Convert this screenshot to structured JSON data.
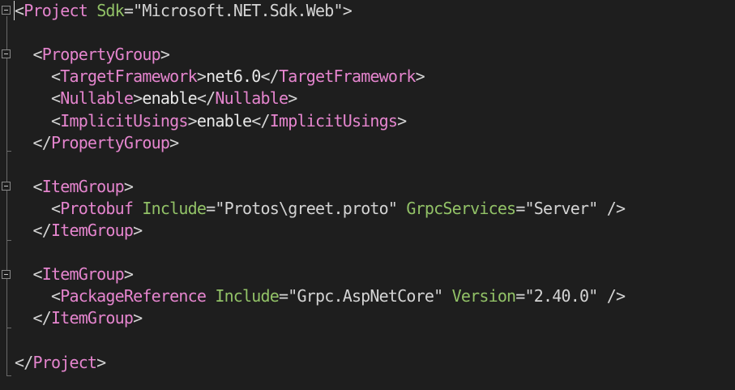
{
  "editor": {
    "language": "xml",
    "colors": {
      "background": "#1e1e1e",
      "punctuation": "#d4d4d4",
      "tag": "#e585ce",
      "attribute": "#92c267",
      "text": "#e8e8e8"
    },
    "lines": [
      {
        "indent": "",
        "tokens": [
          {
            "t": "<",
            "k": "punct"
          },
          {
            "t": "Project",
            "k": "tag"
          },
          {
            "t": " ",
            "k": "text"
          },
          {
            "t": "Sdk",
            "k": "attr"
          },
          {
            "t": "=\"Microsoft.NET.Sdk.Web\">",
            "k": "punct"
          }
        ]
      },
      {
        "indent": "",
        "tokens": []
      },
      {
        "indent": "  ",
        "tokens": [
          {
            "t": "<",
            "k": "punct"
          },
          {
            "t": "PropertyGroup",
            "k": "tag"
          },
          {
            "t": ">",
            "k": "punct"
          }
        ]
      },
      {
        "indent": "    ",
        "tokens": [
          {
            "t": "<",
            "k": "punct"
          },
          {
            "t": "TargetFramework",
            "k": "tag"
          },
          {
            "t": ">",
            "k": "punct"
          },
          {
            "t": "net6.0",
            "k": "text"
          },
          {
            "t": "</",
            "k": "punct"
          },
          {
            "t": "TargetFramework",
            "k": "tag"
          },
          {
            "t": ">",
            "k": "punct"
          }
        ]
      },
      {
        "indent": "    ",
        "tokens": [
          {
            "t": "<",
            "k": "punct"
          },
          {
            "t": "Nullable",
            "k": "tag"
          },
          {
            "t": ">",
            "k": "punct"
          },
          {
            "t": "enable",
            "k": "text"
          },
          {
            "t": "</",
            "k": "punct"
          },
          {
            "t": "Nullable",
            "k": "tag"
          },
          {
            "t": ">",
            "k": "punct"
          }
        ]
      },
      {
        "indent": "    ",
        "tokens": [
          {
            "t": "<",
            "k": "punct"
          },
          {
            "t": "ImplicitUsings",
            "k": "tag"
          },
          {
            "t": ">",
            "k": "punct"
          },
          {
            "t": "enable",
            "k": "text"
          },
          {
            "t": "</",
            "k": "punct"
          },
          {
            "t": "ImplicitUsings",
            "k": "tag"
          },
          {
            "t": ">",
            "k": "punct"
          }
        ]
      },
      {
        "indent": "  ",
        "tokens": [
          {
            "t": "</",
            "k": "punct"
          },
          {
            "t": "PropertyGroup",
            "k": "tag"
          },
          {
            "t": ">",
            "k": "punct"
          }
        ]
      },
      {
        "indent": "",
        "tokens": []
      },
      {
        "indent": "  ",
        "tokens": [
          {
            "t": "<",
            "k": "punct"
          },
          {
            "t": "ItemGroup",
            "k": "tag"
          },
          {
            "t": ">",
            "k": "punct"
          }
        ]
      },
      {
        "indent": "    ",
        "tokens": [
          {
            "t": "<",
            "k": "punct"
          },
          {
            "t": "Protobuf",
            "k": "tag"
          },
          {
            "t": " ",
            "k": "text"
          },
          {
            "t": "Include",
            "k": "attr"
          },
          {
            "t": "=\"Protos\\greet.proto\" ",
            "k": "punct"
          },
          {
            "t": "GrpcServices",
            "k": "attr"
          },
          {
            "t": "=\"Server\" />",
            "k": "punct"
          }
        ]
      },
      {
        "indent": "  ",
        "tokens": [
          {
            "t": "</",
            "k": "punct"
          },
          {
            "t": "ItemGroup",
            "k": "tag"
          },
          {
            "t": ">",
            "k": "punct"
          }
        ]
      },
      {
        "indent": "",
        "tokens": []
      },
      {
        "indent": "  ",
        "tokens": [
          {
            "t": "<",
            "k": "punct"
          },
          {
            "t": "ItemGroup",
            "k": "tag"
          },
          {
            "t": ">",
            "k": "punct"
          }
        ]
      },
      {
        "indent": "    ",
        "tokens": [
          {
            "t": "<",
            "k": "punct"
          },
          {
            "t": "PackageReference",
            "k": "tag"
          },
          {
            "t": " ",
            "k": "text"
          },
          {
            "t": "Include",
            "k": "attr"
          },
          {
            "t": "=\"Grpc.AspNetCore\" ",
            "k": "punct"
          },
          {
            "t": "Version",
            "k": "attr"
          },
          {
            "t": "=\"2.40.0\" />",
            "k": "punct"
          }
        ]
      },
      {
        "indent": "  ",
        "tokens": [
          {
            "t": "</",
            "k": "punct"
          },
          {
            "t": "ItemGroup",
            "k": "tag"
          },
          {
            "t": ">",
            "k": "punct"
          }
        ]
      },
      {
        "indent": "",
        "tokens": []
      },
      {
        "indent": "",
        "tokens": [
          {
            "t": "</",
            "k": "punct"
          },
          {
            "t": "Project",
            "k": "tag"
          },
          {
            "t": ">",
            "k": "punct"
          }
        ]
      }
    ]
  }
}
